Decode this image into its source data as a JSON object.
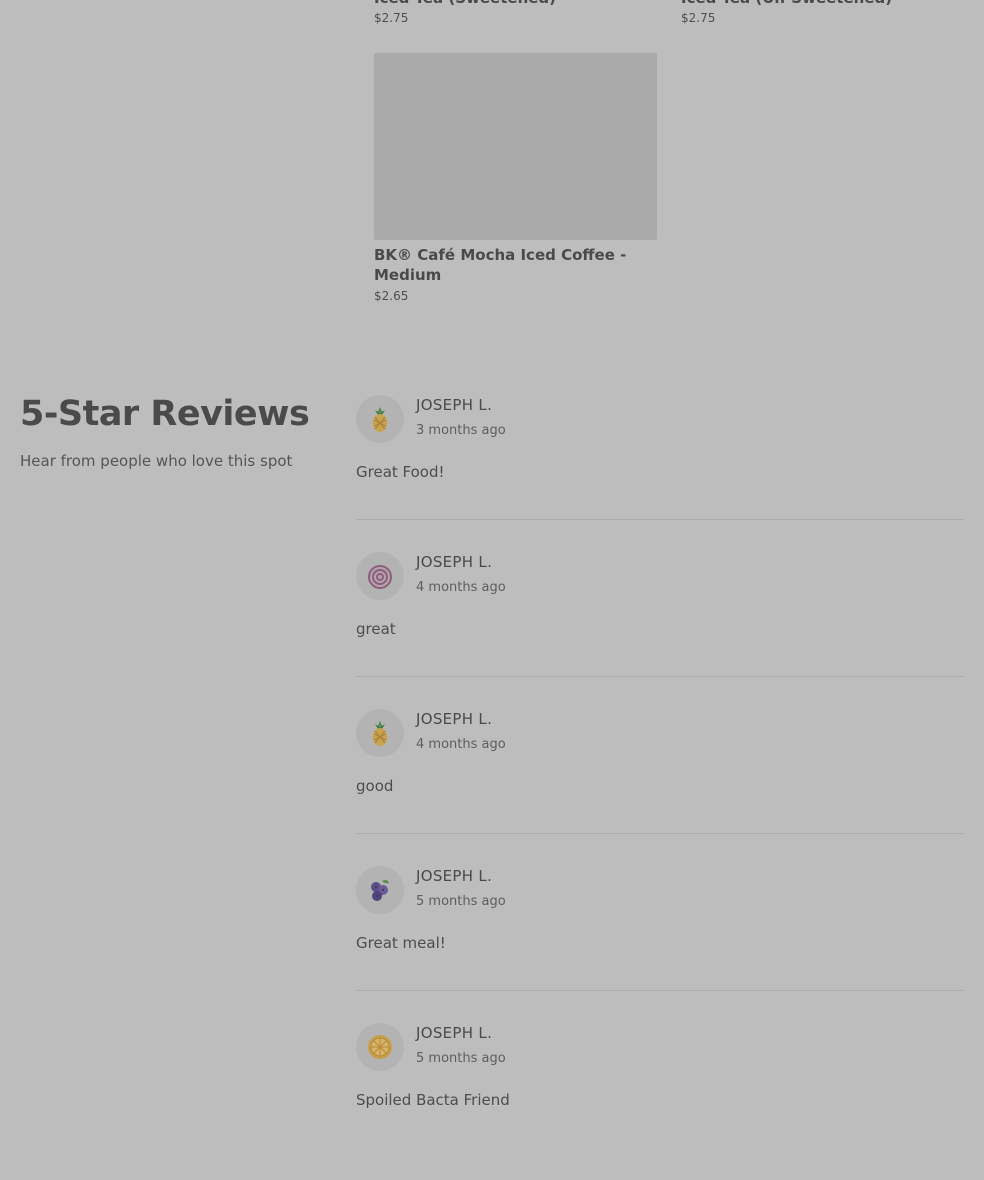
{
  "products": [
    {
      "name": "Iced Tea (Sweetened)",
      "price": "$2.75"
    },
    {
      "name": "Iced Tea (Un-Sweetened)",
      "price": "$2.75"
    },
    {
      "name": "BK® Café Mocha Iced Coffee - Medium",
      "price": "$2.65"
    }
  ],
  "reviews_section": {
    "title": "5-Star Reviews",
    "subtitle": "Hear from people who love this spot"
  },
  "reviews": [
    {
      "name": "JOSEPH L.",
      "date": "3 months ago",
      "text": "Great Food!",
      "avatar_icon": "pineapple-icon"
    },
    {
      "name": "JOSEPH L.",
      "date": "4 months ago",
      "text": "great",
      "avatar_icon": "onion-icon"
    },
    {
      "name": "JOSEPH L.",
      "date": "4 months ago",
      "text": "good",
      "avatar_icon": "pineapple-icon"
    },
    {
      "name": "JOSEPH L.",
      "date": "5 months ago",
      "text": "Great meal!",
      "avatar_icon": "blueberry-icon"
    },
    {
      "name": "JOSEPH L.",
      "date": "5 months ago",
      "text": "Spoiled Bacta Friend",
      "avatar_icon": "orange-slice-icon"
    }
  ],
  "colors": {
    "overlay_bg": "#bdbdbd",
    "image_placeholder": "#aaaaaa",
    "divider": "#ababab"
  }
}
